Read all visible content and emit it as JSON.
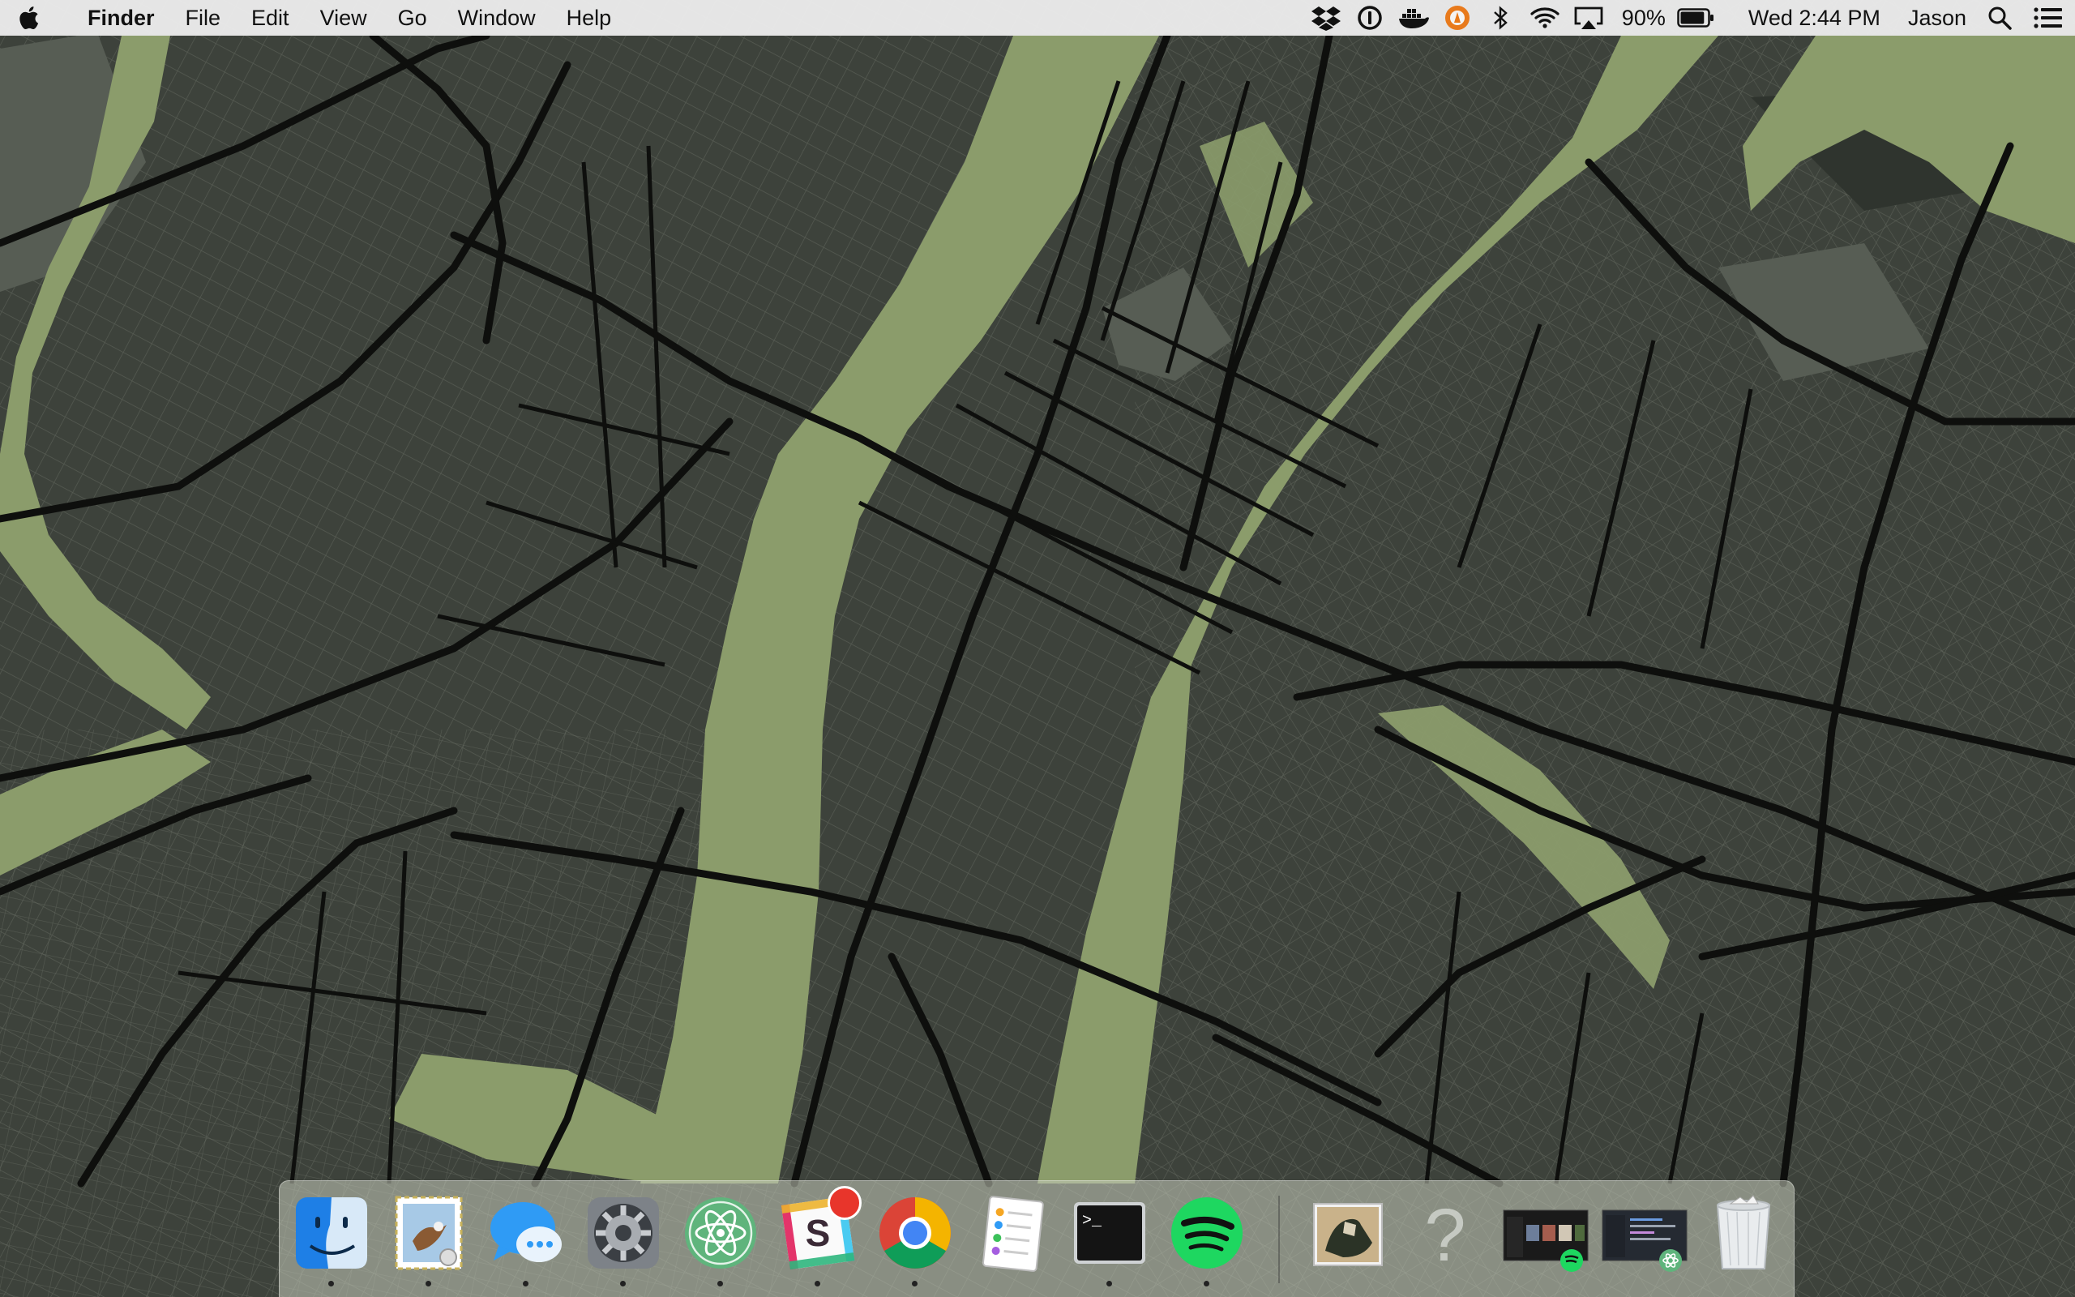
{
  "menubar": {
    "apple_icon": "apple-icon",
    "app_name": "Finder",
    "menus": [
      "File",
      "Edit",
      "View",
      "Go",
      "Window",
      "Help"
    ],
    "status_icons": [
      "dropbox-icon",
      "onepassword-icon",
      "docker-icon",
      "vlc-icon",
      "bluetooth-icon",
      "wifi-icon",
      "airplay-icon"
    ],
    "battery_percent": "90%",
    "battery_level": 0.9,
    "clock": "Wed 2:44 PM",
    "user": "Jason",
    "right_icons": [
      "spotlight-search-icon",
      "notification-center-icon"
    ]
  },
  "dock": {
    "apps": [
      {
        "name": "Finder",
        "icon": "finder-icon",
        "running": true
      },
      {
        "name": "Mail",
        "icon": "mail-icon",
        "running": true
      },
      {
        "name": "Messages",
        "icon": "messages-icon",
        "running": true
      },
      {
        "name": "System Preferences",
        "icon": "system-preferences-icon",
        "running": true
      },
      {
        "name": "Atom",
        "icon": "atom-icon",
        "running": true
      },
      {
        "name": "Slack",
        "icon": "slack-icon",
        "running": true,
        "badge": true
      },
      {
        "name": "Google Chrome",
        "icon": "chrome-icon",
        "running": true
      },
      {
        "name": "Reminders",
        "icon": "reminders-icon",
        "running": false
      },
      {
        "name": "Terminal",
        "icon": "terminal-icon",
        "running": true
      },
      {
        "name": "Spotify",
        "icon": "spotify-icon",
        "running": true
      }
    ],
    "others": [
      {
        "name": "Downloads stack",
        "icon": "downloads-stack-icon"
      },
      {
        "name": "Unknown item",
        "icon": "question-mark-icon"
      },
      {
        "name": "Minimized Spotify window",
        "icon": "minimized-window-spotify-icon"
      },
      {
        "name": "Minimized Atom window",
        "icon": "minimized-window-atom-icon"
      },
      {
        "name": "Trash",
        "icon": "trash-icon"
      }
    ]
  },
  "colors": {
    "land": "#3d423b",
    "water": "#8b9c6b",
    "park": "#575d54",
    "roads": "#0e0f0d",
    "streets": "#6b7066"
  }
}
